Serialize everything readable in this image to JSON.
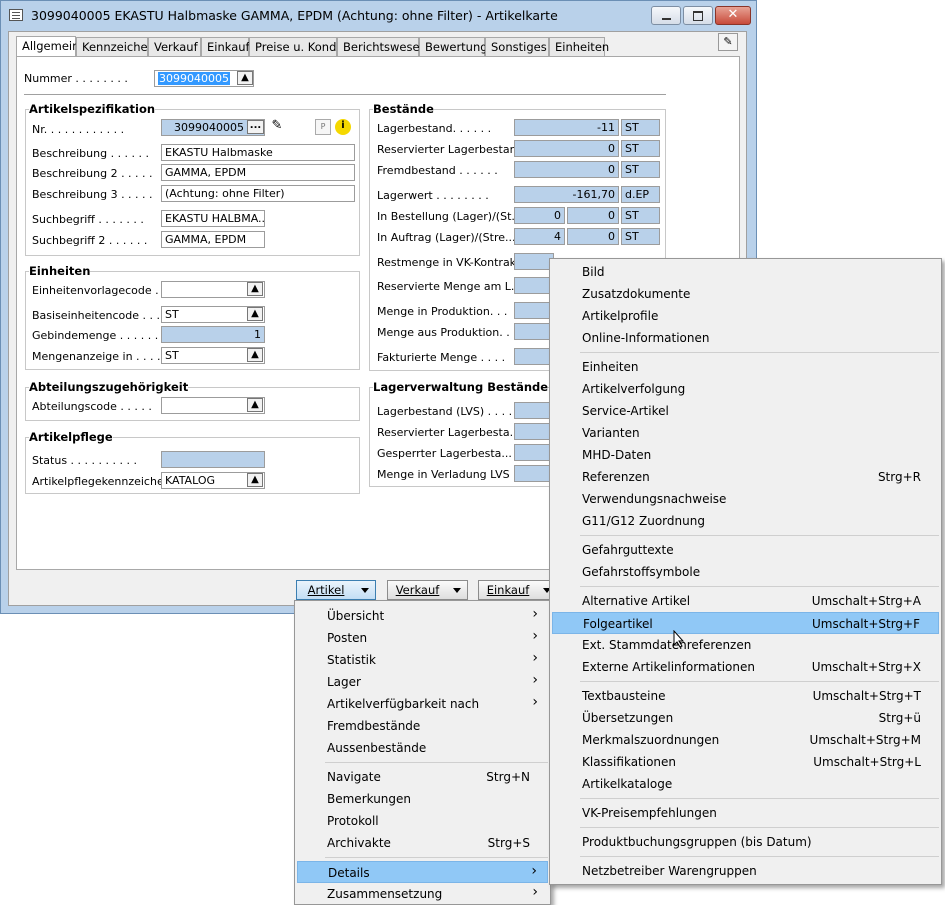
{
  "window": {
    "title": "3099040005 EKASTU Halbmaske GAMMA, EPDM (Achtung: ohne Filter) - Artikelkarte",
    "close_label": "✕"
  },
  "tabs": [
    "Allgemein",
    "Kennzeichen",
    "Verkauf",
    "Einkauf",
    "Preise u. Kond.",
    "Berichtswesen",
    "Bewertung",
    "Sonstiges",
    "Einheiten"
  ],
  "nummer": {
    "label": "Nummer . . . . . . . .",
    "value": "3099040005"
  },
  "spec": {
    "title": "Artikelspezifikation",
    "nr_label": "Nr. . . . . . . . . . . .",
    "nr_value": "3099040005",
    "beschreibung_label": "Beschreibung . . . . . .",
    "beschreibung_value": "EKASTU Halbmaske",
    "beschreibung2_label": "Beschreibung 2 . . . . .",
    "beschreibung2_value": "GAMMA, EPDM",
    "beschreibung3_label": "Beschreibung 3 . . . . .",
    "beschreibung3_value": "(Achtung: ohne Filter)",
    "such_label": "Suchbegriff . . . . . . .",
    "such_value": "EKASTU HALBMA...",
    "such2_label": "Suchbegriff 2 . . . . . .",
    "such2_value": "GAMMA, EPDM"
  },
  "einheiten": {
    "title": "Einheiten",
    "vorlage_label": "Einheitenvorlagecode . .",
    "vorlage_value": "",
    "basis_label": "Basiseinheitencode . . .",
    "basis_value": "ST",
    "gebinde_label": "Gebindemenge . . . . . .",
    "gebinde_value": "1",
    "mengenanzeige_label": "Mengenanzeige in . . . .",
    "mengenanzeige_value": "ST"
  },
  "abteilung": {
    "title": "Abteilungszugehörigkeit",
    "code_label": "Abteilungscode . . . . .",
    "code_value": ""
  },
  "pflege": {
    "title": "Artikelpflege",
    "status_label": "Status . . . . . . . . . .",
    "status_value": "",
    "kenn_label": "Artikelpflegekennzeichen.",
    "kenn_value": "KATALOG"
  },
  "bestaende": {
    "title": "Bestände",
    "rows": [
      {
        "label": "Lagerbestand. . . . . .",
        "v1": "",
        "v2": "-11",
        "unit": "ST"
      },
      {
        "label": "Reservierter Lagerbestand",
        "v1": "",
        "v2": "0",
        "unit": "ST"
      },
      {
        "label": "Fremdbestand . . . . . .",
        "v1": "",
        "v2": "0",
        "unit": "ST"
      },
      {
        "label": "Lagerwert . . . . . . . .",
        "v1": "",
        "v2": "-161,70",
        "unit": "d.EP"
      },
      {
        "label": "In Bestellung (Lager)/(St...",
        "v1": "0",
        "v2": "0",
        "unit": "ST"
      },
      {
        "label": "In Auftrag (Lager)/(Stre...",
        "v1": "4",
        "v2": "0",
        "unit": "ST"
      },
      {
        "label": "Restmenge in VK-Kontrakt.",
        "v1": "",
        "v2": "",
        "unit": ""
      },
      {
        "label": "Reservierte Menge am L...",
        "v1": "",
        "v2": "",
        "unit": ""
      },
      {
        "label": "Menge in Produktion. . .",
        "v1": "",
        "v2": "",
        "unit": ""
      },
      {
        "label": "Menge aus Produktion. . .",
        "v1": "",
        "v2": "",
        "unit": ""
      },
      {
        "label": "Fakturierte Menge . . . .",
        "v1": "",
        "v2": "",
        "unit": ""
      }
    ]
  },
  "lvs": {
    "title": "Lagerverwaltung Bestände",
    "rows": [
      {
        "label": "Lagerbestand (LVS) . . . ."
      },
      {
        "label": "Reservierter Lagerbesta..."
      },
      {
        "label": "Gesperrter Lagerbesta..."
      },
      {
        "label": "Menge in Verladung LVS . ."
      }
    ]
  },
  "bottom_buttons": [
    "Artikel",
    "Verkauf",
    "Einkauf"
  ],
  "artikel_menu": [
    {
      "label": "Übersicht",
      "shortcut": "",
      "submenu": true
    },
    {
      "label": "Posten",
      "shortcut": "",
      "submenu": true
    },
    {
      "label": "Statistik",
      "shortcut": "",
      "submenu": true
    },
    {
      "label": "Lager",
      "shortcut": "",
      "submenu": true
    },
    {
      "label": "Artikelverfügbarkeit nach",
      "shortcut": "",
      "submenu": true
    },
    {
      "label": "Fremdbestände",
      "shortcut": "",
      "submenu": false
    },
    {
      "label": "Aussenbestände",
      "shortcut": "",
      "submenu": false
    },
    {
      "label": "Navigate",
      "shortcut": "Strg+N",
      "submenu": false
    },
    {
      "label": "Bemerkungen",
      "shortcut": "",
      "submenu": false
    },
    {
      "label": "Protokoll",
      "shortcut": "",
      "submenu": false
    },
    {
      "label": "Archivakte",
      "shortcut": "Strg+S",
      "submenu": false
    },
    {
      "label": "Details",
      "shortcut": "",
      "submenu": true
    },
    {
      "label": "Zusammensetzung",
      "shortcut": "",
      "submenu": true
    }
  ],
  "details_menu": [
    {
      "label": "Bild",
      "shortcut": ""
    },
    {
      "label": "Zusatzdokumente",
      "shortcut": ""
    },
    {
      "label": "Artikelprofile",
      "shortcut": ""
    },
    {
      "label": "Online-Informationen",
      "shortcut": ""
    },
    {
      "label": "Einheiten",
      "shortcut": ""
    },
    {
      "label": "Artikelverfolgung",
      "shortcut": ""
    },
    {
      "label": "Service-Artikel",
      "shortcut": ""
    },
    {
      "label": "Varianten",
      "shortcut": ""
    },
    {
      "label": "MHD-Daten",
      "shortcut": ""
    },
    {
      "label": "Referenzen",
      "shortcut": "Strg+R"
    },
    {
      "label": "Verwendungsnachweise",
      "shortcut": ""
    },
    {
      "label": "G11/G12 Zuordnung",
      "shortcut": ""
    },
    {
      "label": "Gefahrguttexte",
      "shortcut": ""
    },
    {
      "label": "Gefahrstoffsymbole",
      "shortcut": ""
    },
    {
      "label": "Alternative Artikel",
      "shortcut": "Umschalt+Strg+A"
    },
    {
      "label": "Folgeartikel",
      "shortcut": "Umschalt+Strg+F"
    },
    {
      "label": "Ext. Stammdatenreferenzen",
      "shortcut": ""
    },
    {
      "label": "Externe Artikelinformationen",
      "shortcut": "Umschalt+Strg+X"
    },
    {
      "label": "Textbausteine",
      "shortcut": "Umschalt+Strg+T"
    },
    {
      "label": "Übersetzungen",
      "shortcut": "Strg+ü"
    },
    {
      "label": "Merkmalszuordnungen",
      "shortcut": "Umschalt+Strg+M"
    },
    {
      "label": "Klassifikationen",
      "shortcut": "Umschalt+Strg+L"
    },
    {
      "label": "Artikelkataloge",
      "shortcut": ""
    },
    {
      "label": "VK-Preisempfehlungen",
      "shortcut": ""
    },
    {
      "label": "Produktbuchungsgruppen (bis Datum)",
      "shortcut": ""
    },
    {
      "label": "Netzbetreiber Warengruppen",
      "shortcut": ""
    }
  ],
  "colors": {
    "highlight": "#90c8f6",
    "field_blue": "#b9d1ea",
    "titlebar": "#b9d1ea"
  }
}
